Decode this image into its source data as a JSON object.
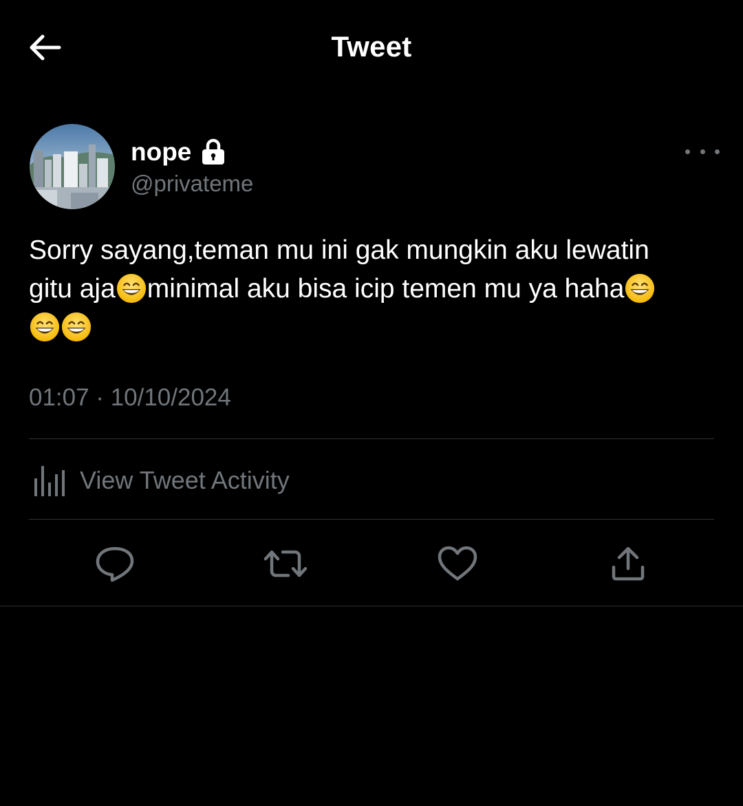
{
  "header": {
    "title": "Tweet",
    "back_icon": "arrow-left-icon"
  },
  "tweet": {
    "author": {
      "display_name": "nope",
      "handle": "@privateme",
      "protected_icon": "lock-icon",
      "avatar_icon": "cityscape-avatar"
    },
    "text": {
      "line1": "Sorry sayang,teman mu ini gak mungkin aku lewatin",
      "line2_a": "gitu aja",
      "line2_b": "minimal aku bisa icip temen mu ya haha",
      "emoji_name": "grinning-face-with-smiling-eyes"
    },
    "timestamp": "01:07 · 10/10/2024",
    "activity_label": "View Tweet Activity"
  },
  "actions": [
    "reply-icon",
    "retweet-icon",
    "like-icon",
    "share-icon"
  ],
  "colors": {
    "background": "#000000",
    "text": "#ffffff",
    "muted": "#71767b",
    "divider": "#2f3336"
  }
}
